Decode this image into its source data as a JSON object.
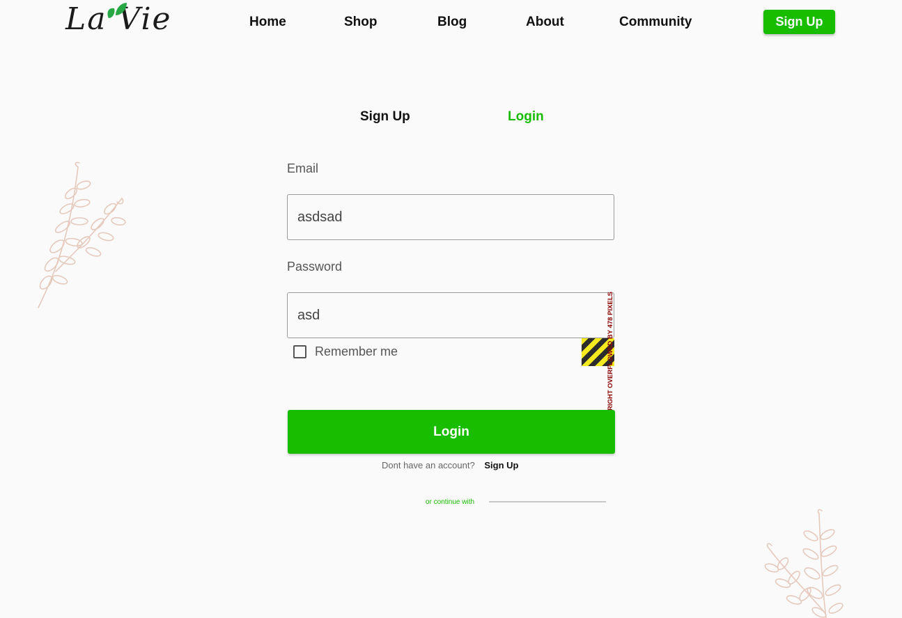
{
  "brand": {
    "logo_text": "La Vie",
    "accent_color": "#18bd00",
    "leaf_color": "#28a745",
    "branch_color": "#e6c9bd"
  },
  "nav": {
    "items": [
      {
        "label": "Home"
      },
      {
        "label": "Shop"
      },
      {
        "label": "Blog"
      },
      {
        "label": "About"
      },
      {
        "label": "Community"
      }
    ],
    "signup_button": "Sign Up"
  },
  "auth_tabs": {
    "signup": "Sign Up",
    "login": "Login",
    "active": "login"
  },
  "form": {
    "email_label": "Email",
    "email_value": "asdsad",
    "password_label": "Password",
    "password_value": "asd",
    "remember_label": "Remember me",
    "remember_checked": false,
    "submit_label": "Login",
    "no_account_text": "Dont have an account?",
    "signup_link": "Sign Up",
    "continue_with": "or continue with"
  },
  "debug_overlay": {
    "overflow_message": "RIGHT OVERFLOWED BY 478 PIXELS"
  }
}
